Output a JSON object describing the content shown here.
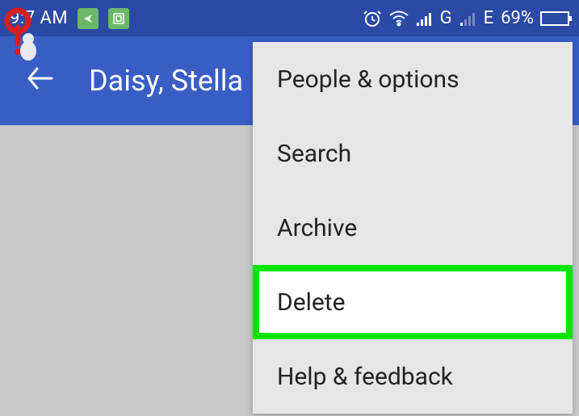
{
  "statusBar": {
    "time": "9:7 AM",
    "signalG": "G",
    "signalE": "E",
    "batteryPercent": "69%"
  },
  "appBar": {
    "title": "Daisy, Stella"
  },
  "menu": {
    "items": [
      {
        "label": "People & options"
      },
      {
        "label": "Search"
      },
      {
        "label": "Archive"
      },
      {
        "label": "Delete"
      },
      {
        "label": "Help & feedback"
      }
    ]
  }
}
